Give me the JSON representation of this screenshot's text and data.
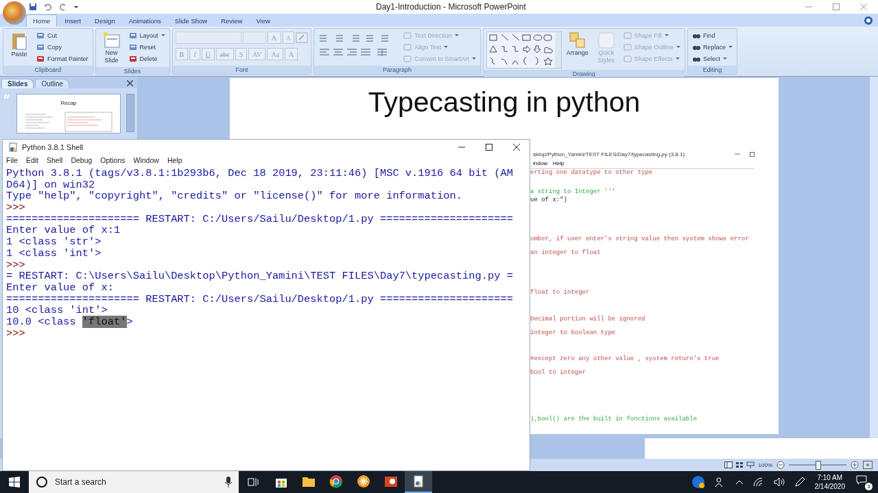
{
  "powerpoint": {
    "title": "Day1-Introduction - Microsoft PowerPoint",
    "tabs": [
      {
        "label": "Home",
        "selected": true
      },
      {
        "label": "Insert",
        "selected": false
      },
      {
        "label": "Design",
        "selected": false
      },
      {
        "label": "Animations",
        "selected": false
      },
      {
        "label": "Slide Show",
        "selected": false
      },
      {
        "label": "Review",
        "selected": false
      },
      {
        "label": "View",
        "selected": false
      }
    ],
    "ribbon": [
      {
        "kind": "clipboard",
        "label": "Clipboard",
        "big": "Paste",
        "items": [
          {
            "label": "Cut",
            "disabled": false,
            "dropdown": false
          },
          {
            "label": "Copy",
            "disabled": false,
            "dropdown": false
          },
          {
            "label": "Format Painter",
            "disabled": false,
            "dropdown": false
          }
        ]
      },
      {
        "kind": "slides",
        "label": "Slides",
        "big": "New Slide",
        "items": [
          {
            "label": "Layout",
            "disabled": false,
            "dropdown": true
          },
          {
            "label": "Reset",
            "disabled": false,
            "dropdown": false
          },
          {
            "label": "Delete",
            "disabled": false,
            "dropdown": false
          }
        ]
      },
      {
        "kind": "font",
        "label": "Font",
        "disabled": true,
        "size_buttons": [
          "A",
          "A"
        ],
        "buttons": [
          "B",
          "I",
          "U",
          "abc",
          "S",
          "AV",
          "Aa",
          "A"
        ]
      },
      {
        "kind": "paragraph",
        "label": "Paragraph",
        "items": [
          {
            "label": "Text Direction",
            "disabled": true,
            "dropdown": true
          },
          {
            "label": "Align Text",
            "disabled": true,
            "dropdown": true
          },
          {
            "label": "Convert to SmartArt",
            "disabled": true,
            "dropdown": true
          }
        ]
      },
      {
        "kind": "drawing",
        "label": "Drawing",
        "big": "Arrange",
        "big2": {
          "label": "Quick Styles",
          "disabled": true
        },
        "items": [
          {
            "label": "Shape Fill",
            "disabled": true,
            "dropdown": true
          },
          {
            "label": "Shape Outline",
            "disabled": true,
            "dropdown": true
          },
          {
            "label": "Shape Effects",
            "disabled": true,
            "dropdown": true
          }
        ]
      },
      {
        "kind": "editing",
        "label": "Editing",
        "items": [
          {
            "label": "Find",
            "disabled": false,
            "dropdown": false
          },
          {
            "label": "Replace",
            "disabled": false,
            "dropdown": true
          },
          {
            "label": "Select",
            "disabled": false,
            "dropdown": true
          }
        ]
      }
    ],
    "panel_tabs": [
      {
        "label": "Slides",
        "selected": true
      },
      {
        "label": "Outline",
        "selected": false
      }
    ],
    "thumbnail": {
      "title": "Recap"
    },
    "slide": {
      "title": "Typecasting in python",
      "editor": {
        "title": "sktop/Python_Yamini/TEST FILES/Day7/typecasting.py (3.8.1)",
        "menu": [
          "indow",
          "Help"
        ],
        "lines": [
          {
            "kind": "comment",
            "text": "erting one datatype to other type"
          },
          {
            "kind": "string",
            "text": "a string to Integer '''"
          },
          {
            "kind": "code",
            "text": "ue of x:\")"
          },
          {
            "kind": "comment",
            "text": "umber, if user enter's string value then system shows error"
          },
          {
            "kind": "comment",
            "text": " an integer to float"
          },
          {
            "kind": "comment",
            "text": " float to integer"
          },
          {
            "kind": "comment",
            "text": "Decimal portion will be ignored"
          },
          {
            "kind": "comment",
            "text": " integer to boolean type"
          },
          {
            "kind": "comment",
            "text": "#except zero any other value , system return's true"
          },
          {
            "kind": "comment",
            "text": " bool to integer"
          },
          {
            "kind": "string",
            "text": "),bool() are the built in functions available"
          }
        ]
      }
    },
    "status": {
      "zoom": "100%",
      "level": 0.5
    }
  },
  "shell": {
    "title": "Python 3.8.1 Shell",
    "menu": [
      "File",
      "Edit",
      "Shell",
      "Debug",
      "Options",
      "Window",
      "Help"
    ],
    "lines": [
      {
        "kind": "output",
        "text": "Python 3.8.1 (tags/v3.8.1:1b293b6, Dec 18 2019, 23:11:46) [MSC v.1916 64 bit (AM"
      },
      {
        "kind": "output",
        "text": "D64)] on win32"
      },
      {
        "kind": "output",
        "text": "Type \"help\", \"copyright\", \"credits\" or \"license()\" for more information."
      },
      {
        "kind": "prompt",
        "text": ">>>"
      },
      {
        "kind": "restart",
        "text": "===================== RESTART: C:/Users/Sailu/Desktop/1.py ====================="
      },
      {
        "kind": "output",
        "text": "Enter value of x:1"
      },
      {
        "kind": "output",
        "text": "1 <class 'str'>"
      },
      {
        "kind": "output",
        "text": "1 <class 'int'>"
      },
      {
        "kind": "prompt",
        "text": ">>>"
      },
      {
        "kind": "restart",
        "text": "= RESTART: C:\\Users\\Sailu\\Desktop\\Python_Yamini\\TEST FILES\\Day7\\typecasting.py ="
      },
      {
        "kind": "output",
        "text": "Enter value of x:"
      },
      {
        "kind": "restart",
        "text": "===================== RESTART: C:/Users/Sailu/Desktop/1.py ====================="
      },
      {
        "kind": "output",
        "text": "10 <class 'int'>"
      },
      {
        "kind": "output",
        "text": "10.0 <class ",
        "selection": "'float'",
        "tail": ">"
      },
      {
        "kind": "prompt",
        "text": ">>>"
      }
    ]
  },
  "taskbar": {
    "search_placeholder": "Start a search",
    "apps": [
      {
        "kind": "store",
        "active": false
      },
      {
        "kind": "folder",
        "active": false
      },
      {
        "kind": "browser",
        "active": false
      },
      {
        "kind": "asterisk",
        "active": false
      },
      {
        "kind": "presentation",
        "active": false
      },
      {
        "kind": "python",
        "active": true
      }
    ],
    "time": "7:10 AM",
    "date": "2/14/2020",
    "notifications": "3"
  }
}
